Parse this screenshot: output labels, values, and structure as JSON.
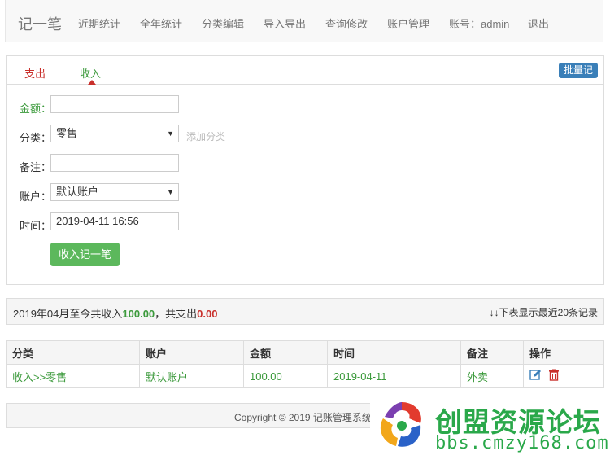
{
  "navbar": {
    "brand": "记一笔",
    "items": [
      "近期统计",
      "全年统计",
      "分类编辑",
      "导入导出",
      "查询修改",
      "账户管理",
      "账号：admin",
      "退出"
    ]
  },
  "panel": {
    "tabs": {
      "expense": "支出",
      "income": "收入"
    },
    "batch_button": "批量记",
    "form": {
      "amount_label": "金额：",
      "amount_value": "",
      "category_label": "分类：",
      "category_value": "零售",
      "add_category": "添加分类",
      "note_label": "备注：",
      "note_value": "",
      "account_label": "账户：",
      "account_value": "默认账户",
      "time_label": "时间：",
      "time_value": "2019-04-11 16:56",
      "submit": "收入记一笔"
    }
  },
  "summary": {
    "prefix": "2019年04月至今共收入",
    "income": "100.00",
    "middle": "，共支出",
    "expense": "0.00",
    "right": "↓↓下表显示最近20条记录"
  },
  "table": {
    "headers": [
      "分类",
      "账户",
      "金额",
      "时间",
      "备注",
      "操作"
    ],
    "rows": [
      {
        "category": "收入>>零售",
        "account": "默认账户",
        "amount": "100.00",
        "time": "2019-04-11",
        "note": "外卖"
      }
    ]
  },
  "footer": {
    "text": "Copyright © 2019 记账管理系统"
  },
  "watermark": {
    "title": "创盟资源论坛",
    "url": "bbs.cmzy168.com"
  },
  "colors": {
    "green": "#3c9a3c",
    "red": "#c9302c",
    "button_green": "#5cb85c",
    "batch_blue": "#3a7fb8"
  }
}
